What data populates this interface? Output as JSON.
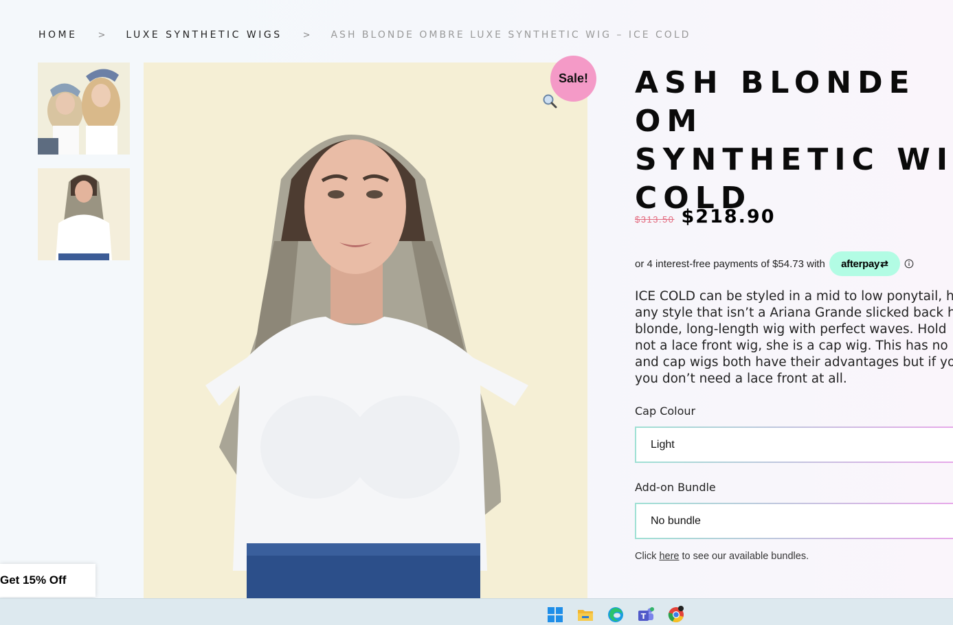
{
  "breadcrumb": {
    "home": "HOME",
    "sep1": ">",
    "category": "LUXE SYNTHETIC WIGS",
    "sep2": ">",
    "current": "ASH BLONDE OMBRE LUXE SYNTHETIC WIG – ICE COLD"
  },
  "gallery": {
    "sale_badge": "Sale!",
    "zoom_icon": "magnifier-icon",
    "thumbnails": [
      "two-women-thumbnail",
      "woman-ash-blonde-wig-thumbnail"
    ],
    "main_image": "woman-ash-blonde-ombre-wig"
  },
  "product": {
    "title": "ASH BLONDE OMBRE LUXE SYNTHETIC WIG – ICE COLD",
    "title_line1": "ASH BLONDE OM",
    "title_line2": "SYNTHETIC WIG",
    "title_line3": "COLD",
    "old_price": "$313.50",
    "new_price": "$218.90",
    "afterpay_text": "or 4 interest-free payments of $54.73 with",
    "afterpay_label": "afterpay",
    "afterpay_mark": "⇄",
    "description_lines": [
      "ICE COLD can be styled in a mid to low ponytail, h",
      "any style that isn’t a Ariana Grande slicked back h",
      "blonde, long-length wig with perfect waves. Hold",
      "not a lace front wig, she is a cap wig. This has no",
      "and cap wigs both have their advantages but if yo",
      "you don’t need a lace front at all."
    ]
  },
  "options": {
    "cap_colour_label": "Cap Colour",
    "cap_colour_value": "Light",
    "addon_label": "Add-on Bundle",
    "addon_value": "No bundle",
    "bundle_note_prefix": "Click ",
    "bundle_note_link": "here",
    "bundle_note_suffix": " to see our available bundles."
  },
  "discount_tab": {
    "label": "Get 15% Off"
  },
  "taskbar": {
    "icons": [
      "windows-start-icon",
      "file-explorer-icon",
      "edge-browser-icon",
      "teams-icon",
      "chrome-icon"
    ]
  },
  "colors": {
    "sale_pink": "#f49ac7",
    "old_price_red": "#e3697e",
    "afterpay_mint": "#b2fce4",
    "image_background": "#f5efd5"
  }
}
